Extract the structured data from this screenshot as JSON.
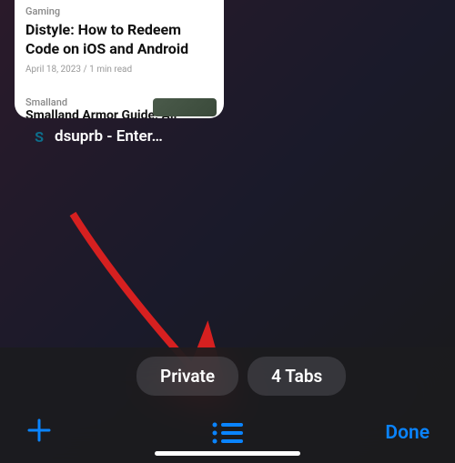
{
  "tab_card": {
    "article1": {
      "category": "Gaming",
      "title": "Distyle: How to Redeem Code on iOS and Android",
      "meta": "April 18, 2023 / 1 min read"
    },
    "article2": {
      "category": "Smalland",
      "title": "Smalland Armor Guide: All"
    }
  },
  "tab_label": {
    "favicon_text": "S",
    "title": "dsuprb - Enter…"
  },
  "tab_groups": {
    "private": "Private",
    "tabs_count": "4 Tabs"
  },
  "toolbar": {
    "done_label": "Done"
  }
}
